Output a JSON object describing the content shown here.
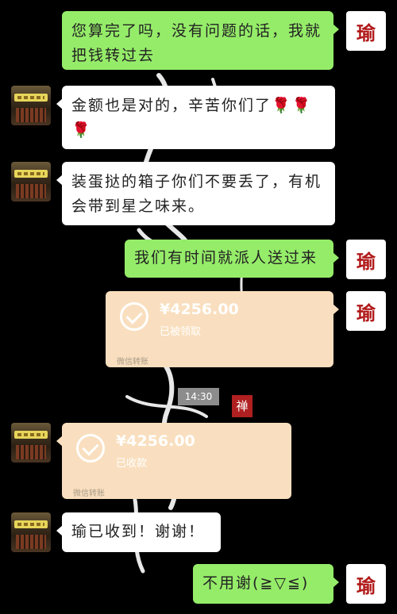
{
  "chat": {
    "self_avatar_char": "瑜",
    "timestamp": "14:30",
    "seal_text": "禅",
    "messages": [
      {
        "text": "您算完了吗，没有问题的话，我就把钱转过去"
      },
      {
        "text": "金额也是对的，辛苦你们了🌹🌹🌹"
      },
      {
        "text": "装蛋挞的箱子你们不要丢了，有机会带到星之味来。"
      },
      {
        "text": "我们有时间就派人送过来"
      },
      {
        "amount": "¥4256.00",
        "status": "已被领取",
        "footer": "微信转账"
      },
      {
        "amount": "¥4256.00",
        "status": "已收款",
        "footer": "微信转账"
      },
      {
        "text": "瑜已收到！谢谢！"
      },
      {
        "text": "不用谢(≧▽≦)"
      }
    ]
  },
  "colors": {
    "self_bubble": "#95ec69",
    "other_bubble": "#ffffff",
    "transfer_card": "#f9dfbf",
    "background": "#000000"
  }
}
